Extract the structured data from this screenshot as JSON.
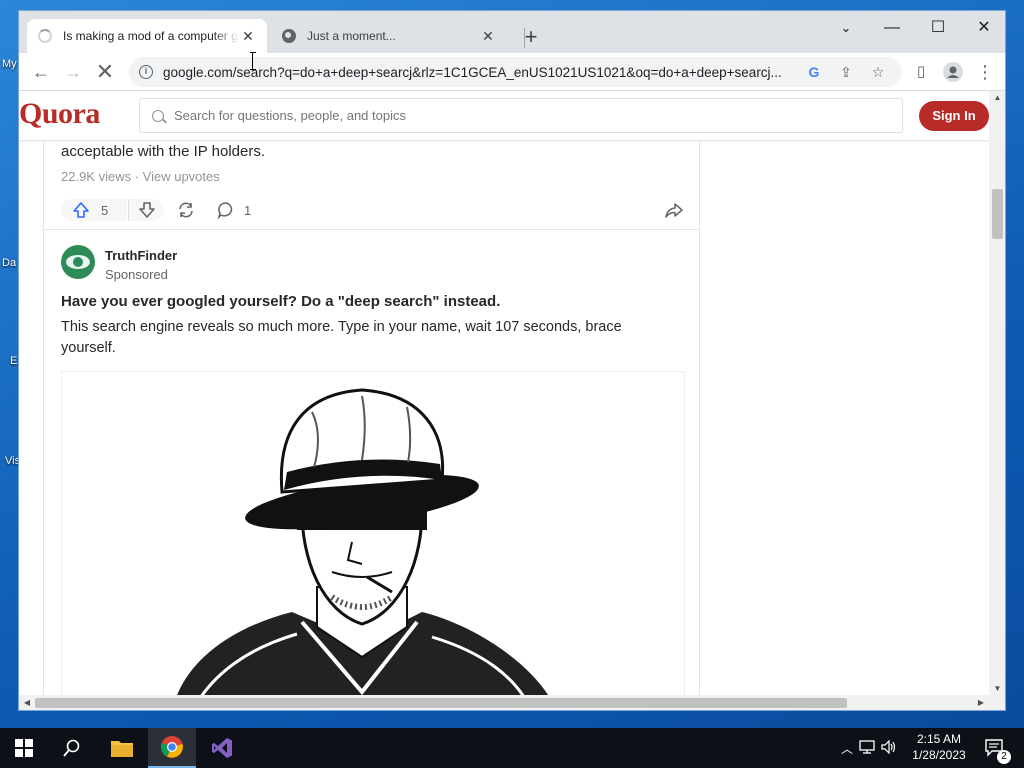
{
  "desktop": {
    "icon_labels": [
      "My",
      "Da",
      "E",
      "Vis"
    ]
  },
  "browser": {
    "tabs": [
      {
        "title": "Is making a mod of a computer g",
        "active": true,
        "favicon": "loading-spinner-icon"
      },
      {
        "title": "Just a moment...",
        "active": false,
        "favicon": "globe-icon"
      }
    ],
    "url": "google.com/search?q=do+a+deep+searcj&rlz=1C1GCEA_enUS1021US1021&oq=do+a+deep+searcj...",
    "accent": "#dee1e6"
  },
  "quora": {
    "logo": "Quora",
    "brand_color": "#b92b27",
    "search_placeholder": "Search for questions, people, and topics",
    "sign_in_label": "Sign In",
    "answer": {
      "text_tail": "acceptable with the IP holders.",
      "views": "22.9K views",
      "separator": " · ",
      "upvotes_link": "View upvotes",
      "upvote_count": "5",
      "comment_count": "1"
    },
    "ad": {
      "advertiser": "TruthFinder",
      "sponsored_label": "Sponsored",
      "headline": "Have you ever googled yourself? Do a \"deep search\" instead.",
      "body": "This search engine reveals so much more. Type in your name, wait 107 seconds, brace yourself."
    }
  },
  "taskbar": {
    "time": "2:15 AM",
    "date": "1/28/2023",
    "notification_count": "2"
  }
}
